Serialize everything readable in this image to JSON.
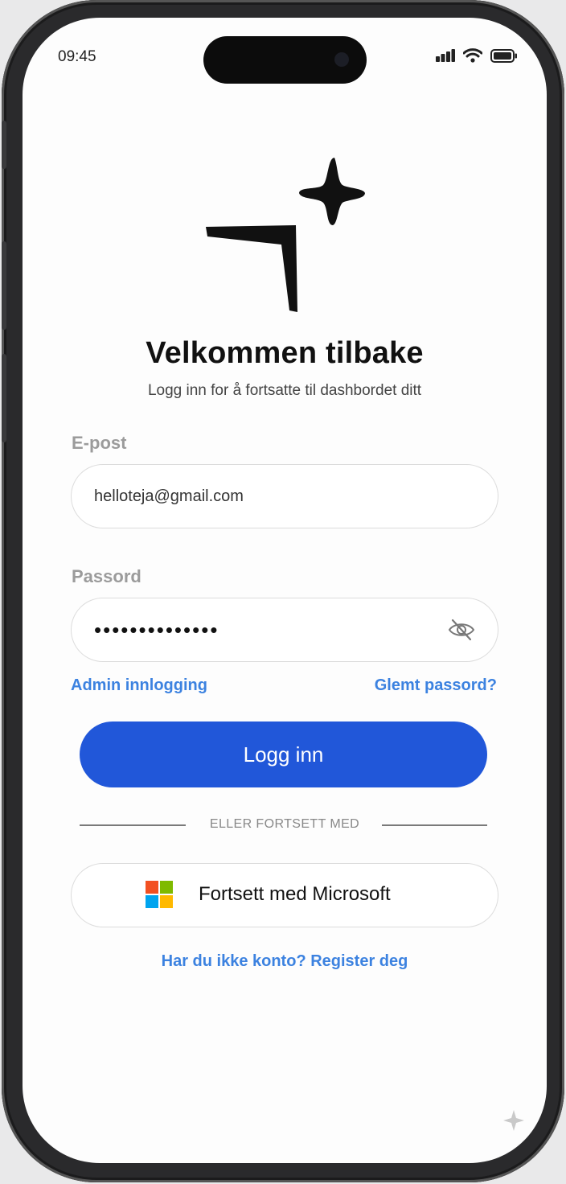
{
  "status": {
    "time": "09:45"
  },
  "header": {
    "title": "Velkommen tilbake",
    "subtitle": "Logg inn for å fortsatte til dashbordet ditt"
  },
  "form": {
    "email_label": "E-post",
    "email_value": "helloteja@gmail.com",
    "password_label": "Passord",
    "password_value": "••••••••••••••",
    "admin_link": "Admin innlogging",
    "forgot_link": "Glemt passord?",
    "submit_label": "Logg inn"
  },
  "alt": {
    "divider_text": "ELLER FORTSETT MED",
    "microsoft_label": "Fortsett med Microsoft"
  },
  "footer": {
    "signup_link": "Har du ikke konto? Register deg"
  },
  "colors": {
    "primary": "#2157d9",
    "link": "#3c82e0",
    "ms_red": "#f25022",
    "ms_green": "#7fba00",
    "ms_blue": "#00a4ef",
    "ms_yellow": "#ffb900"
  }
}
